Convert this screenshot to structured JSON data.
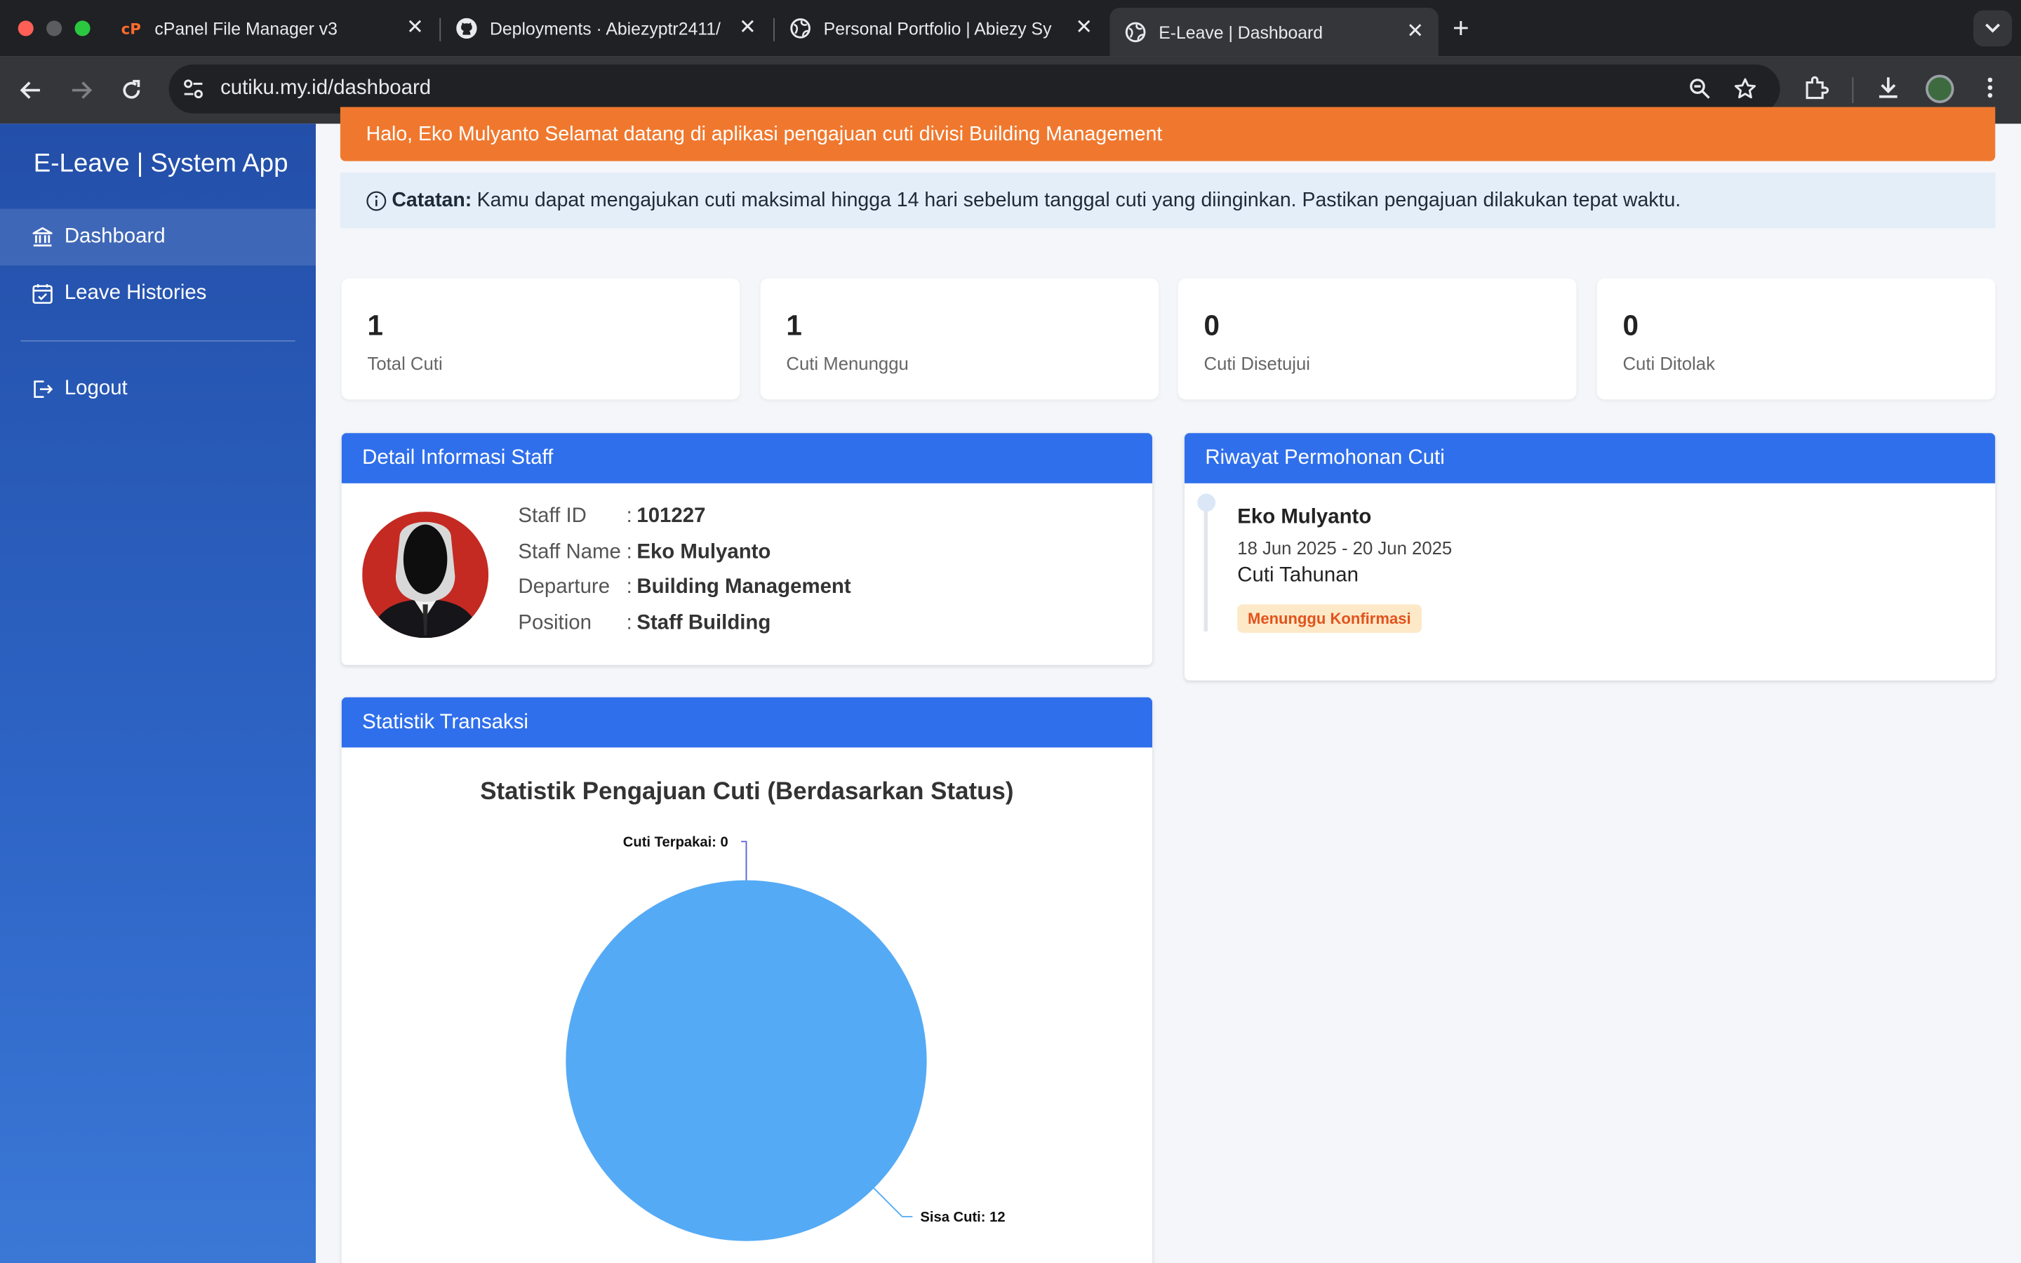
{
  "browser": {
    "tabs": [
      {
        "title": "cPanel File Manager v3",
        "icon": "cpanel-icon"
      },
      {
        "title": "Deployments · Abiezyptr2411/",
        "icon": "github-icon"
      },
      {
        "title": "Personal Portfolio | Abiezy Sy",
        "icon": "globe-icon"
      },
      {
        "title": "E-Leave | Dashboard",
        "icon": "globe-icon"
      }
    ],
    "url": "cutiku.my.id/dashboard"
  },
  "sidebar": {
    "brand": "E-Leave | System App",
    "items": [
      {
        "label": "Dashboard",
        "icon": "bank-icon"
      },
      {
        "label": "Leave Histories",
        "icon": "calendar-check-icon"
      },
      {
        "label": "Logout",
        "icon": "logout-icon"
      }
    ]
  },
  "alerts": {
    "welcome": "Halo, Eko Mulyanto Selamat datang di aplikasi pengajuan cuti divisi Building Management",
    "note_label": "Catatan:",
    "note_text": "Kamu dapat mengajukan cuti maksimal hingga 14 hari sebelum tanggal cuti yang diinginkan. Pastikan pengajuan dilakukan tepat waktu."
  },
  "stats": [
    {
      "value": "1",
      "label": "Total Cuti"
    },
    {
      "value": "1",
      "label": "Cuti Menunggu"
    },
    {
      "value": "0",
      "label": "Cuti Disetujui"
    },
    {
      "value": "0",
      "label": "Cuti Ditolak"
    }
  ],
  "staff": {
    "header": "Detail Informasi Staff",
    "rows": [
      {
        "key": "Staff ID",
        "value": "101227"
      },
      {
        "key": "Staff Name",
        "value": "Eko Mulyanto"
      },
      {
        "key": "Departure",
        "value": "Building Management"
      },
      {
        "key": "Position",
        "value": "Staff Building"
      }
    ]
  },
  "history": {
    "header": "Riwayat Permohonan Cuti",
    "entries": [
      {
        "name": "Eko Mulyanto",
        "dates": "18 Jun 2025 - 20 Jun 2025",
        "type": "Cuti Tahunan",
        "status": "Menunggu Konfirmasi"
      }
    ]
  },
  "statistics": {
    "header": "Statistik Transaksi"
  },
  "chart_data": {
    "type": "pie",
    "title": "Statistik Pengajuan Cuti (Berdasarkan Status)",
    "labels": [
      "Cuti Terpakai",
      "Sisa Cuti"
    ],
    "values": [
      0,
      12
    ],
    "colors": [
      "#5a5fd6",
      "#55aaf5"
    ]
  }
}
